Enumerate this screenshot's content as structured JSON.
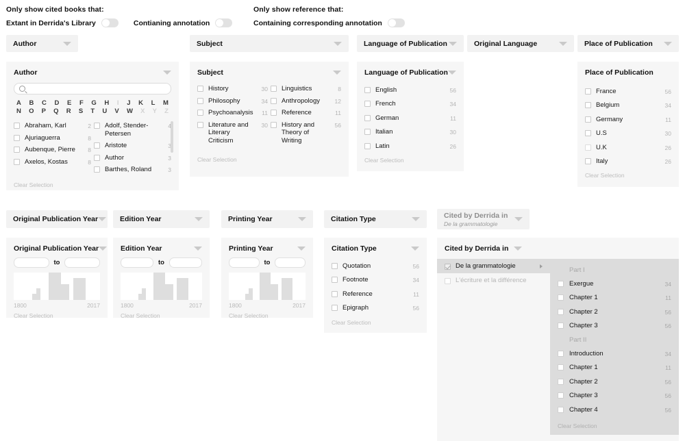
{
  "toggles": {
    "left_group_title": "Only show cited books that:",
    "left_items": [
      {
        "label": "Extant in Derrida's Library",
        "on": false
      },
      {
        "label": "Contianing annotation",
        "on": false
      }
    ],
    "right_group_title": "Only show reference that:",
    "right_items": [
      {
        "label": "Containing corresponding annotation",
        "on": false
      }
    ]
  },
  "pills": [
    {
      "label": "Author"
    },
    {
      "label": "Subject"
    },
    {
      "label": "Language of Publication"
    },
    {
      "label": "Original Language"
    },
    {
      "label": "Place of Publication"
    },
    {
      "label": "Original Publication Year"
    },
    {
      "label": "Edition Year"
    },
    {
      "label": "Printing Year"
    },
    {
      "label": "Citation Type"
    },
    {
      "label": "Cited by Derrida in",
      "sublabel": "De la grammatologie"
    }
  ],
  "author": {
    "title": "Author",
    "search_placeholder": "",
    "search_value": "",
    "alphabet_row1": [
      {
        "ch": "A",
        "off": false
      },
      {
        "ch": "B",
        "off": false
      },
      {
        "ch": "C",
        "off": false
      },
      {
        "ch": "D",
        "off": false
      },
      {
        "ch": "E",
        "off": false
      },
      {
        "ch": "F",
        "off": false
      },
      {
        "ch": "G",
        "off": false
      },
      {
        "ch": "H",
        "off": false
      },
      {
        "ch": "I",
        "off": true
      },
      {
        "ch": "J",
        "off": false
      },
      {
        "ch": "K",
        "off": false
      },
      {
        "ch": "L",
        "off": false
      },
      {
        "ch": "M",
        "off": false
      }
    ],
    "alphabet_row2": [
      {
        "ch": "N",
        "off": false
      },
      {
        "ch": "O",
        "off": false
      },
      {
        "ch": "P",
        "off": false
      },
      {
        "ch": "Q",
        "off": false
      },
      {
        "ch": "R",
        "off": false
      },
      {
        "ch": "S",
        "off": false
      },
      {
        "ch": "T",
        "off": false
      },
      {
        "ch": "U",
        "off": false
      },
      {
        "ch": "V",
        "off": false
      },
      {
        "ch": "W",
        "off": false
      },
      {
        "ch": "X",
        "off": true
      },
      {
        "ch": "Y",
        "off": true
      },
      {
        "ch": "Z",
        "off": true
      }
    ],
    "col1": [
      {
        "label": "Abraham, Karl",
        "count": "2"
      },
      {
        "label": "Ajuriaguerra",
        "count": "8"
      },
      {
        "label": "Aubenque, Pierre",
        "count": "8"
      },
      {
        "label": "Axelos, Kostas",
        "count": "8"
      }
    ],
    "col2": [
      {
        "label": "Adolf, Stender-Petersen",
        "count": "4"
      },
      {
        "label": "Aristote",
        "count": "3"
      },
      {
        "label": "Author",
        "count": "3"
      },
      {
        "label": "Barthes, Roland",
        "count": "3"
      }
    ],
    "clear": "Clear Selection"
  },
  "subject": {
    "title": "Subject",
    "col1": [
      {
        "label": "History",
        "count": "30"
      },
      {
        "label": "Philosophy",
        "count": "34"
      },
      {
        "label": "Psychoanalysis",
        "count": "11"
      },
      {
        "label": "Literature and Literary Criticism",
        "count": "30"
      }
    ],
    "col2": [
      {
        "label": "Linguistics",
        "count": "8"
      },
      {
        "label": "Anthropology",
        "count": "12"
      },
      {
        "label": "Reference",
        "count": "11"
      },
      {
        "label": "History and Theory of Writing",
        "count": "56"
      }
    ],
    "clear": "Clear Selection"
  },
  "language": {
    "title": "Language of Publication",
    "items": [
      {
        "label": "English",
        "count": "56"
      },
      {
        "label": "French",
        "count": "34"
      },
      {
        "label": "German",
        "count": "11"
      },
      {
        "label": "Italian",
        "count": "30"
      },
      {
        "label": "Latin",
        "count": "26"
      }
    ],
    "clear": "Clear Selection"
  },
  "place": {
    "title": "Place of Publication",
    "items": [
      {
        "label": "France",
        "count": "56"
      },
      {
        "label": "Belgium",
        "count": "34"
      },
      {
        "label": "Germany",
        "count": "11"
      },
      {
        "label": "U.S",
        "count": "30"
      },
      {
        "label": "U.K",
        "count": "26"
      },
      {
        "label": "Italy",
        "count": "26"
      }
    ],
    "clear": "Clear Selection"
  },
  "years": [
    {
      "title": "Original Publication Year",
      "from_value": "",
      "to_label": "to",
      "to_value": "",
      "axis_min": "1800",
      "axis_max": "2017",
      "clear": "Clear Selection",
      "histogram": [
        0,
        0,
        0,
        0,
        14,
        26,
        0,
        0,
        62,
        62,
        62,
        36,
        36,
        0,
        50,
        50,
        50,
        0,
        0,
        0
      ]
    },
    {
      "title": "Edition Year",
      "from_value": "",
      "to_label": "to",
      "to_value": "",
      "axis_min": "1800",
      "axis_max": "2017",
      "clear": "Clear Selection",
      "histogram": [
        0,
        0,
        0,
        0,
        14,
        26,
        0,
        0,
        62,
        62,
        62,
        36,
        36,
        0,
        50,
        50,
        50,
        0,
        0,
        0
      ]
    },
    {
      "title": "Printing Year",
      "from_value": "",
      "to_label": "to",
      "to_value": "",
      "axis_min": "1800",
      "axis_max": "2017",
      "clear": "Clear Selection",
      "histogram": [
        0,
        0,
        0,
        0,
        14,
        26,
        0,
        0,
        62,
        62,
        62,
        36,
        36,
        0,
        50,
        50,
        50,
        0,
        0,
        0
      ]
    }
  ],
  "citation": {
    "title": "Citation Type",
    "items": [
      {
        "label": "Quotation",
        "count": "56"
      },
      {
        "label": "Footnote",
        "count": "34"
      },
      {
        "label": "Reference",
        "count": "11"
      },
      {
        "label": "Epigraph",
        "count": "56"
      }
    ],
    "clear": "Clear Selection"
  },
  "cited_by": {
    "title": "Cited by Derrida in",
    "books": [
      {
        "label": "De la grammatologie",
        "checked": true,
        "active": true,
        "dim": false
      },
      {
        "label": "L'écriture et la différence",
        "checked": false,
        "active": false,
        "dim": true
      }
    ],
    "sections": [
      {
        "part": "Part I",
        "items": [
          {
            "label": "Exergue",
            "count": "34"
          },
          {
            "label": "Chapter 1",
            "count": "11"
          },
          {
            "label": "Chapter 2",
            "count": "56"
          },
          {
            "label": "Chapter 3",
            "count": "56"
          }
        ]
      },
      {
        "part": "Part II",
        "items": [
          {
            "label": "Introduction",
            "count": "34"
          },
          {
            "label": "Chapter 1",
            "count": "11"
          },
          {
            "label": "Chapter 2",
            "count": "56"
          },
          {
            "label": "Chapter 3",
            "count": "56"
          },
          {
            "label": "Chapter 4",
            "count": "56"
          }
        ]
      }
    ],
    "clear": "Clear Selection"
  }
}
